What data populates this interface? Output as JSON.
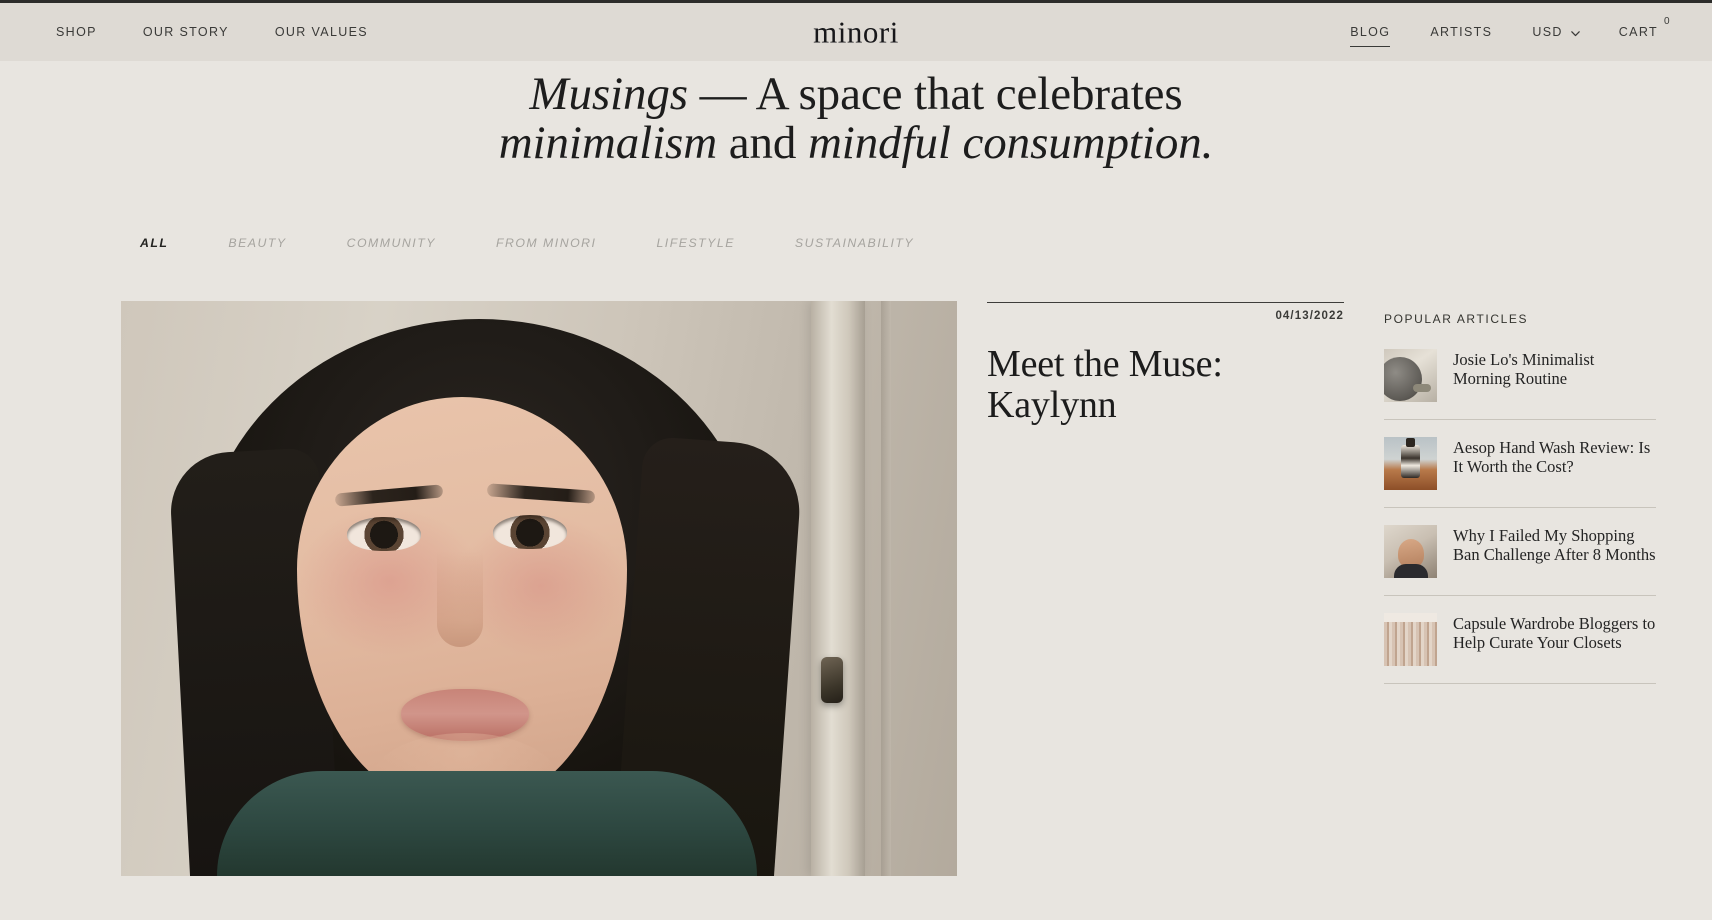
{
  "brand": {
    "name": "minori"
  },
  "nav": {
    "left": [
      {
        "label": "SHOP"
      },
      {
        "label": "OUR STORY"
      },
      {
        "label": "OUR VALUES"
      }
    ],
    "right": [
      {
        "label": "BLOG",
        "active": true
      },
      {
        "label": "ARTISTS",
        "active": false
      }
    ],
    "currency": {
      "label": "USD",
      "icon": "chevron-down-icon"
    },
    "cart": {
      "label": "CART",
      "count": "0"
    }
  },
  "hero": {
    "line1_italic": "Musings",
    "line1_roman": " — A space that celebrates",
    "line2_italic_a": "minimalism",
    "line2_roman": " and ",
    "line2_italic_b": "mindful consumption."
  },
  "filters": [
    {
      "label": "ALL",
      "active": true
    },
    {
      "label": "BEAUTY",
      "active": false
    },
    {
      "label": "COMMUNITY",
      "active": false
    },
    {
      "label": "FROM MINORI",
      "active": false
    },
    {
      "label": "LIFESTYLE",
      "active": false
    },
    {
      "label": "SUSTAINABILITY",
      "active": false
    }
  ],
  "feature": {
    "image_alt": "portrait-of-kaylynn",
    "date": "04/13/2022",
    "title": "Meet the Muse: Kaylynn"
  },
  "popular": {
    "heading": "POPULAR ARTICLES",
    "items": [
      {
        "title": "Josie Lo's Minimalist Morning Routine",
        "thumb": "mirror-and-tray-thumbnail"
      },
      {
        "title": "Aesop Hand Wash Review: Is It Worth the Cost?",
        "thumb": "hand-wash-bottle-thumbnail"
      },
      {
        "title": "Why I Failed My Shopping Ban Challenge After 8 Months",
        "thumb": "woman-in-sunlight-thumbnail"
      },
      {
        "title": "Capsule Wardrobe Bloggers to Help Curate Your Closets",
        "thumb": "hanging-fabric-thumbnail"
      }
    ]
  },
  "colors": {
    "page_bg": "#e8e5e0",
    "header_bg": "#dedad4",
    "text": "#2e2e2c",
    "muted": "#a6a49f",
    "rule": "#c8c4bc"
  }
}
